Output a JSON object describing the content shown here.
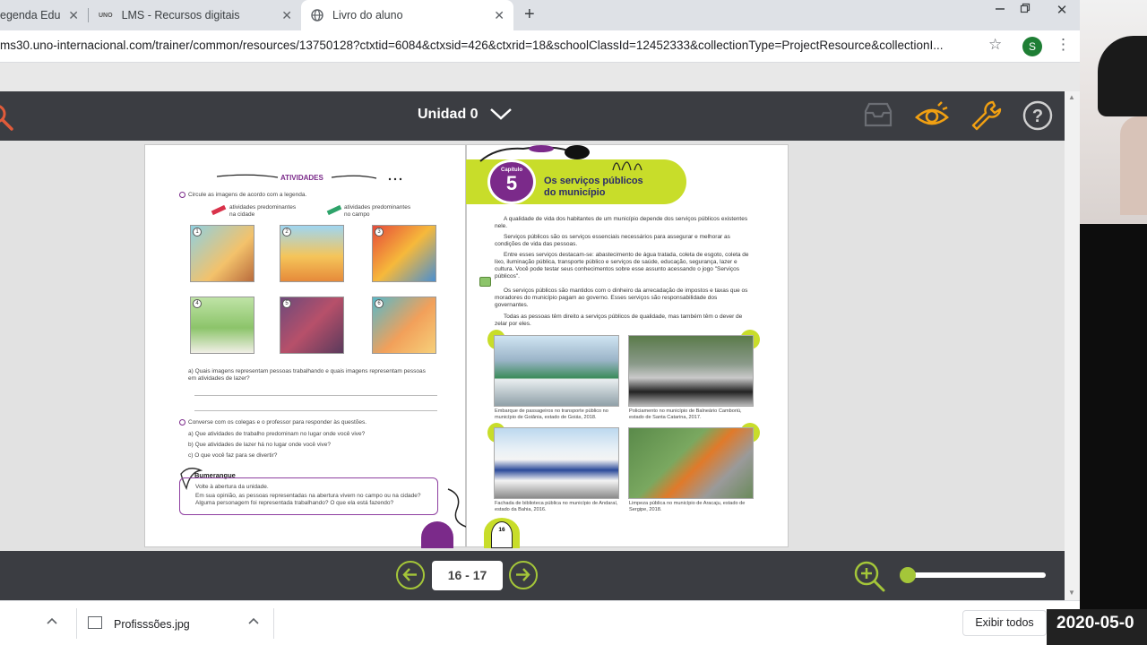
{
  "browser": {
    "tabs": [
      {
        "label": "egenda Edu",
        "active": false
      },
      {
        "label": "LMS - Recursos digitais",
        "active": false,
        "favicon": "UNO"
      },
      {
        "label": "Livro do aluno",
        "active": true
      }
    ],
    "new_tab_glyph": "+",
    "close_glyph": "✕",
    "url": "ms30.uno-internacional.com/trainer/common/resources/13750128?ctxtid=6084&ctxsid=426&ctxrid=18&schoolClassId=12452333&collectionType=ProjectResource&collectionI...",
    "profile_initial": "S"
  },
  "viewer": {
    "title": "Unidad 0",
    "icons": [
      "search-icon",
      "inbox-icon",
      "eye-icon",
      "wrench-icon",
      "help-icon"
    ],
    "page_indicator": "16 - 17",
    "zoom_level": 0.0
  },
  "left_page": {
    "heading": "ATIVIDADES",
    "q1": "Circule as imagens de acordo com a legenda.",
    "legend_city": "atividades predominantes na cidade",
    "legend_country": "atividades predominantes no campo",
    "image_numbers": [
      "1",
      "2",
      "3",
      "4",
      "5",
      "6"
    ],
    "q1a": "a) Quais imagens representam pessoas trabalhando e quais imagens representam pessoas em atividades de lazer?",
    "q2": "Converse com os colegas e o professor para responder às questões.",
    "q2a": "a) Que atividades de trabalho predominam no lugar onde você vive?",
    "q2b": "b) Que atividades de lazer há no lugar onde você vive?",
    "q2c": "c) O que você faz para se divertir?",
    "boomerang_title": "Bumerangue",
    "boomerang_l1": "Volte à abertura da unidade.",
    "boomerang_l2": "Em sua opinião, as pessoas representadas na abertura vivem no campo ou na cidade? Alguma personagem foi representada trabalhando? O que ela está fazendo?"
  },
  "right_page": {
    "chapter_word": "Capítulo",
    "chapter_number": "5",
    "chapter_title_1": "Os serviços públicos",
    "chapter_title_2": "do município",
    "p1": "A qualidade de vida dos habitantes de um município depende dos serviços públicos existentes nele.",
    "p2": "Serviços públicos são os serviços essenciais necessários para assegurar e melhorar as condições de vida das pessoas.",
    "p3": "Entre esses serviços destacam-se: abastecimento de água tratada, coleta de esgoto, coleta de lixo, iluminação pública, transporte público e serviços de saúde, educação, segurança, lazer e cultura. Você pode testar seus conhecimentos sobre esse assunto acessando o jogo \"Serviços públicos\".",
    "p4": "Os serviços públicos são mantidos com o dinheiro da arrecadação de impostos e taxas que os moradores do município pagam ao governo. Esses serviços são responsabilidade dos governantes.",
    "p5": "Todas as pessoas têm direito a serviços públicos de qualidade, mas também têm o dever de zelar por eles.",
    "captions": [
      "Embarque de passageiros no transporte público no município de Goiânia, estado de Goiás, 2018.",
      "Policiamento no município de Balneário Camboriú, estado de Santa Catarina, 2017.",
      "Fachada de biblioteca pública no município de Andaraí, estado da Bahia, 2016.",
      "Limpeza pública no município de Aracaju, estado de Sergipe, 2018."
    ],
    "page_number": "16"
  },
  "downloads": {
    "file_name": "Profisssões.jpg",
    "show_all": "Exibir todos"
  },
  "overlay_timestamp": "2020-05-0"
}
